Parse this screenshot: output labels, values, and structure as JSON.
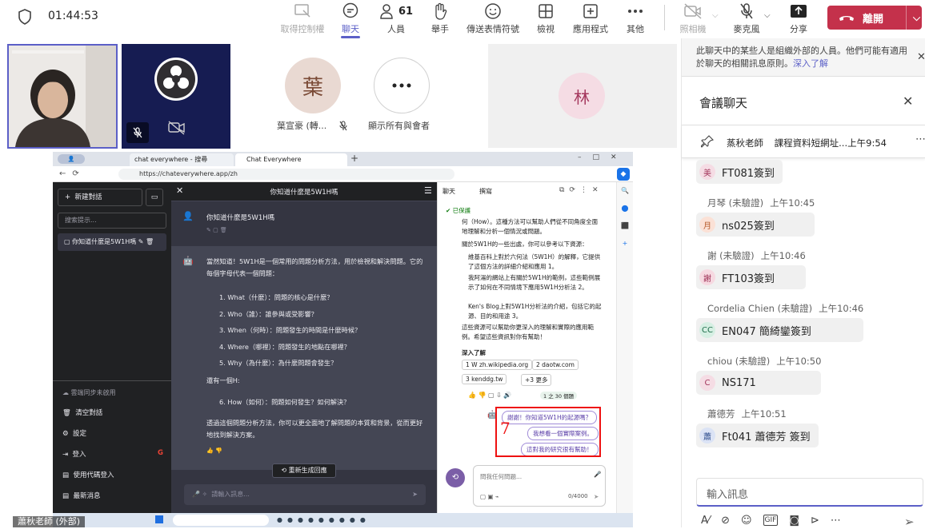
{
  "topbar": {
    "timer": "01:44:53",
    "take_control": "取得控制權",
    "chat": "聊天",
    "people": "人員",
    "people_count": "61",
    "raise_hand": "舉手",
    "reactions": "傳送表情符號",
    "view": "檢視",
    "apps": "應用程式",
    "more": "其他",
    "camera": "照相機",
    "mic": "麥克風",
    "share": "分享",
    "leave": "離開"
  },
  "participants": {
    "tile3_initial": "葉",
    "tile3_name": "葉宣豪 (轉...",
    "show_all_label": "顯示所有與會者",
    "tile5_initial": "林",
    "presenter_label": "蕭秋老師 (外部)"
  },
  "browser": {
    "tab1": "chat everywhere - 搜尋",
    "tab2": "Chat Everywhere",
    "url": "https://chateverywhere.app/zh",
    "new_chat": "新建對話",
    "search_placeholder": "搜索提示...",
    "conv_item": "你知道什麼是5W1H嗎",
    "chat_title": "你知道什麼是5W1H嗎",
    "user_msg": "你知道什麼是5W1H嗎",
    "ai_intro": "當然知道！5W1H是一個常用的問題分析方法，用於檢視和解決問題。它的每個字母代表一個問題：",
    "items": [
      "1.  What（什麼）：問題的核心是什麼？",
      "2.  Who（誰）：誰參與或受影響？",
      "3.  When（何時）：問題發生的時間是什麼時候？",
      "4.  Where（哪裡）：問題發生的地點在哪裡？",
      "5.  Why（為什麼）：為什麼問題會發生？"
    ],
    "also": "還有一個H:",
    "item6": "6.  How（如何）：問題如何發生？如何解決？",
    "summary": "透過這個問題分析方法，你可以更全面地了解問題的本質和背景，從而更好地找到解決方案。",
    "regenerate": "重新生成回應",
    "input_placeholder": "請輸入訊息...",
    "sidebar_sync": "雲端同步未啟用",
    "sidebar_clear": "清空對話",
    "sidebar_settings": "設定",
    "sidebar_login": "登入",
    "sidebar_code": "使用代碼登入",
    "sidebar_news": "最新消息",
    "copilot_chat": "聊天",
    "copilot_compose": "撰寫",
    "copilot_protected": "已保護",
    "copilot_p1": "何（How）。這種方法可以幫助人們從不同角度全面地理解和分析一個情況或問題。",
    "copilot_p2": "關於5W1H的一些出處，你可以參考以下資源：",
    "copilot_b1": "維基百科上對於六何法（5W1H）的解釋，它提供了這個方法的詳細介紹和應用 1。",
    "copilot_b2": "我阿湯的網站上有關於5W1H的範例，這些範例展示了如何在不同情境下應用5W1H分析法 2。",
    "copilot_b3": "Ken's Blog上對5W1H分析法的介紹，包括它的起源、目的和用途 3。",
    "copilot_p3": "這些資源可以幫助你更深入的理解和實際的應用範例。希望這些資訊對你有幫助！",
    "learn_more": "深入了解",
    "src1": "1  W  zh.wikipedia.org",
    "src2": "2  daotw.com",
    "src3": "3  kenddg.tw",
    "src_more": "+3 更多",
    "count": "1 之 30 個題",
    "suggest1": "謝謝！你知道5W1H的起源嗎？",
    "suggest2": "我想看一個實際案例。",
    "suggest3": "這對我的研究很有幫助！",
    "ask_placeholder": "問我任何問題...",
    "char_count": "0/4000",
    "handwriting": "7"
  },
  "panel": {
    "notice": "此聊天中的某些人是組織外部的人員。他們可能有適用於聊天的相關訊息原則。",
    "notice_link": "深入了解",
    "title": "會議聊天",
    "pinned_author": "蒸秋老師",
    "pinned_text": "課程資料短網址...",
    "pinned_time": "上午9:54",
    "messages": [
      {
        "initial": "美",
        "author": "",
        "time": "",
        "text": "FT081簽到",
        "color": "#f5dce4",
        "fg": "#a4375d"
      },
      {
        "initial": "月",
        "author": "月琴 (未驗證)",
        "time": "上午10:45",
        "text": "ns025簽到",
        "color": "#fbe1d6",
        "fg": "#b65b2b"
      },
      {
        "initial": "謝",
        "author": "謝 (未驗證)",
        "time": "上午10:46",
        "text": "FT103簽到",
        "color": "#f6d9e1",
        "fg": "#9b2c52"
      },
      {
        "initial": "CC",
        "author": "Cordelia Chien (未驗證)",
        "time": "上午10:46",
        "text": "EN047 簡綺鑾簽到",
        "color": "#d6efe3",
        "fg": "#1f6e4b"
      },
      {
        "initial": "C",
        "author": "chiou (未驗證)",
        "time": "上午10:50",
        "text": "NS171",
        "color": "#f5dce4",
        "fg": "#a4375d"
      },
      {
        "initial": "蕭",
        "author": "蕭德芳",
        "time": "上午10:51",
        "text": "Ft041 蕭德芳 簽到",
        "color": "#dbe3f5",
        "fg": "#2f4e8e"
      }
    ],
    "input_placeholder": "輸入訊息"
  }
}
